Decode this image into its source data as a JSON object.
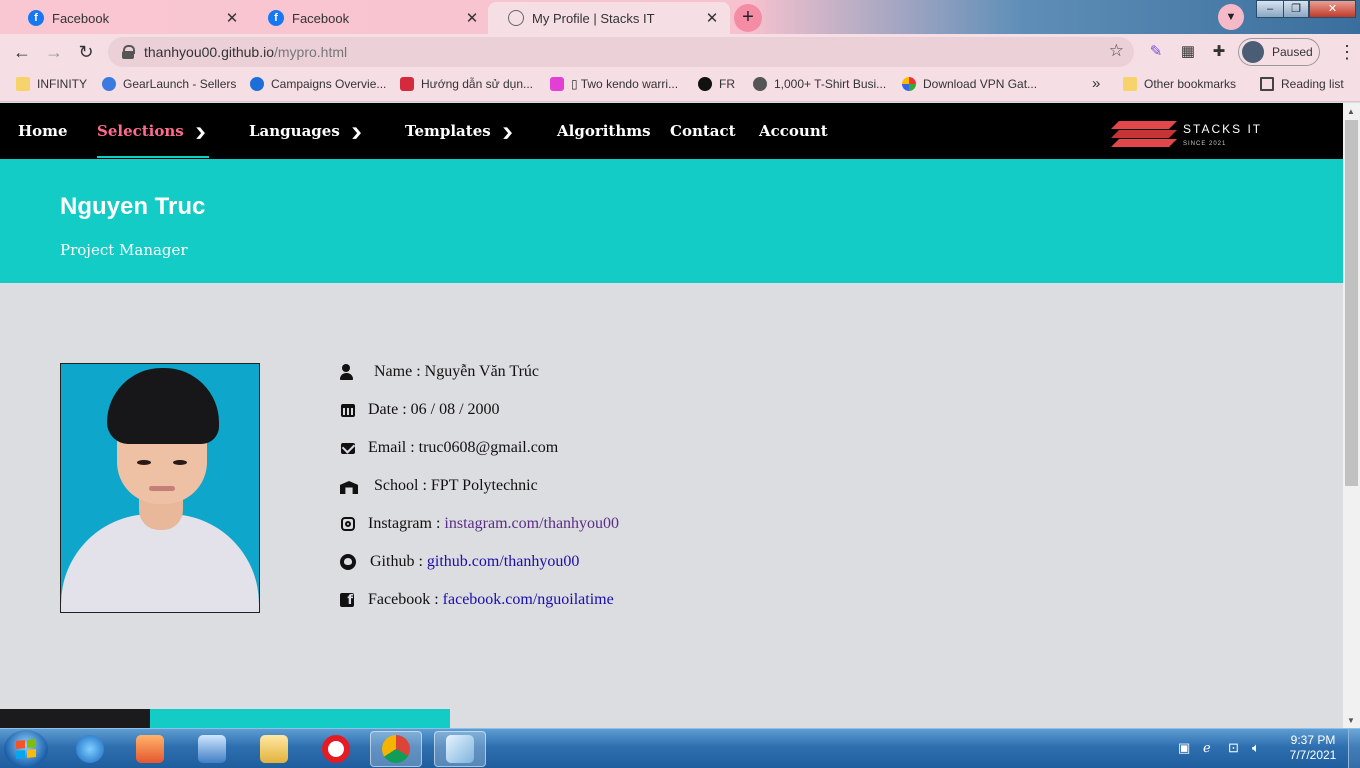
{
  "browser": {
    "tabs": [
      {
        "title": "Facebook",
        "icon": "facebook-icon",
        "active": false
      },
      {
        "title": "Facebook",
        "icon": "facebook-icon",
        "active": false
      },
      {
        "title": "My Profile | Stacks IT",
        "icon": "globe-icon",
        "active": true
      }
    ],
    "new_tab": "+",
    "url_host": "thanhyou00.github.io",
    "url_path": "/mypro.html",
    "profile_status": "Paused",
    "bookmarks": [
      {
        "label": "INFINITY",
        "icon": "folder-icon"
      },
      {
        "label": "GearLaunch - Sellers",
        "icon": "gearlaunch-icon"
      },
      {
        "label": "Campaigns Overvie...",
        "icon": "campaigns-icon"
      },
      {
        "label": "Hướng dẫn sử dụn...",
        "icon": "v-icon"
      },
      {
        "label": "▯ Two kendo warri...",
        "icon": "w-icon"
      },
      {
        "label": "FR",
        "icon": "tiktok-icon"
      },
      {
        "label": "1,000+ T-Shirt Busi...",
        "icon": "ant-icon"
      },
      {
        "label": "Download VPN Gat...",
        "icon": "vpn-icon"
      }
    ],
    "bookmarks_overflow": "»",
    "other_bookmarks": "Other bookmarks",
    "reading_list": "Reading list"
  },
  "site": {
    "nav": [
      {
        "label": "Home",
        "dropdown": false,
        "active": false
      },
      {
        "label": "Selections",
        "dropdown": true,
        "active": true
      },
      {
        "label": "Languages",
        "dropdown": true,
        "active": false
      },
      {
        "label": "Templates",
        "dropdown": true,
        "active": false
      },
      {
        "label": "Algorithms",
        "dropdown": false,
        "active": false
      },
      {
        "label": "Contact",
        "dropdown": false,
        "active": false
      },
      {
        "label": "Account",
        "dropdown": false,
        "active": false
      }
    ],
    "brand_name": "STACKS IT",
    "brand_since": "SINCE 2021",
    "accent_color": "#13ccc6",
    "active_nav_color": "#ff6b8e"
  },
  "profile": {
    "name": "Nguyen Truc",
    "role": "Project Manager",
    "details": [
      {
        "icon": "user-shield-icon",
        "label": "Name :",
        "value": "Nguyễn Văn Trúc",
        "link": false
      },
      {
        "icon": "calendar-icon",
        "label": "Date :",
        "value": "06 / 08 / 2000",
        "link": false
      },
      {
        "icon": "envelope-icon",
        "label": "Email :",
        "value": "truc0608@gmail.com",
        "link": false
      },
      {
        "icon": "school-icon",
        "label": "School :",
        "value": "FPT Polytechnic",
        "link": false
      },
      {
        "icon": "instagram-icon",
        "label": "Instagram :",
        "value": "instagram.com/thanhyou00",
        "link": true,
        "visited": true
      },
      {
        "icon": "github-icon",
        "label": "Github :",
        "value": "github.com/thanhyou00",
        "link": true,
        "visited": false
      },
      {
        "icon": "facebook-square-icon",
        "label": "Facebook :",
        "value": "facebook.com/nguoilatime",
        "link": true,
        "visited": false
      }
    ]
  },
  "taskbar": {
    "apps": [
      "ie-icon",
      "media-player-icon",
      "network-icon",
      "explorer-icon",
      "opera-icon",
      "chrome-icon",
      "notepad-icon"
    ],
    "time": "9:37 PM",
    "date": "7/7/2021"
  }
}
